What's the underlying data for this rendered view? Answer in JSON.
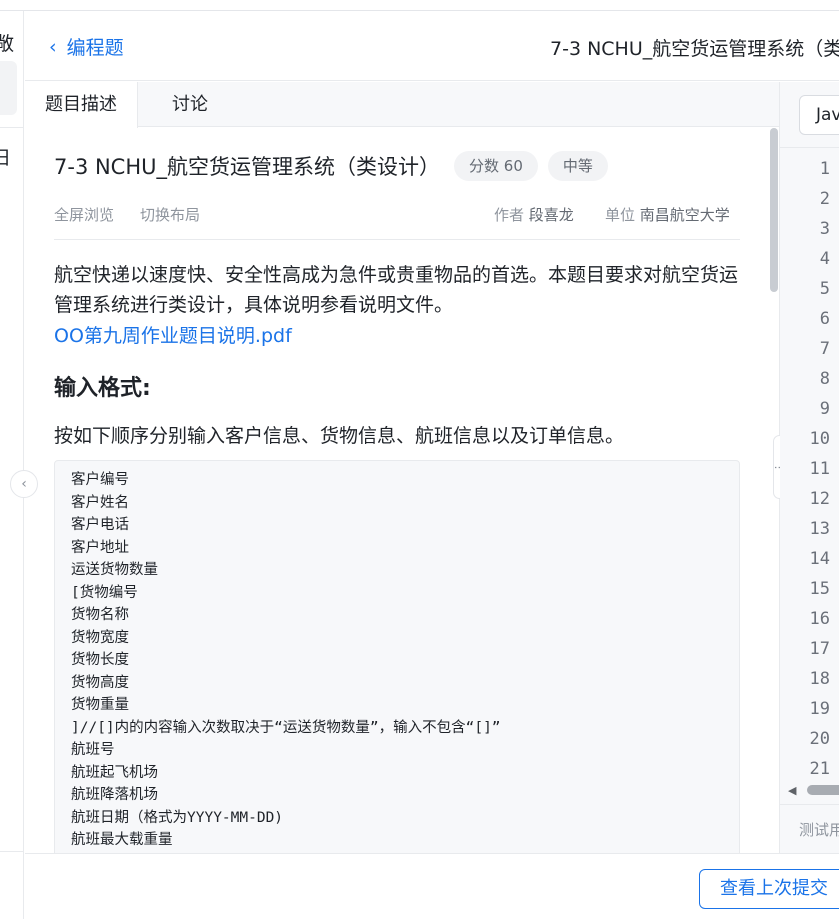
{
  "nav": {
    "fragment_top": "敞",
    "fragment_mid": "日"
  },
  "header": {
    "back_label": "编程题",
    "title": "7-3 NCHU_航空货运管理系统（类"
  },
  "tabs": [
    {
      "label": "题目描述",
      "active": true
    },
    {
      "label": "讨论",
      "active": false
    }
  ],
  "problem": {
    "title": "7-3 NCHU_航空货运管理系统（类设计）",
    "score_chip": "分数 60",
    "difficulty_chip": "中等",
    "actions": [
      "全屏浏览",
      "切换布局"
    ],
    "author_label": "作者",
    "author": "段喜龙",
    "unit_label": "单位",
    "unit": "南昌航空大学",
    "description": "航空快递以速度快、安全性高成为急件或贵重物品的首选。本题目要求对航空货运管理系统进行类设计，具体说明参看说明文件。",
    "attachment": "OO第九周作业题目说明.pdf",
    "input_heading": "输入格式:",
    "input_intro": "按如下顺序分别输入客户信息、货物信息、航班信息以及订单信息。",
    "input_lines": [
      "客户编号",
      "客户姓名",
      "客户电话",
      "客户地址",
      "运送货物数量",
      "[货物编号",
      "货物名称",
      "货物宽度",
      "货物长度",
      "货物高度",
      "货物重量",
      "]//[]内的内容输入次数取决于“运送货物数量”，输入不包含“[]”",
      "航班号",
      "航班起飞机场",
      "航班降落机场",
      "航班日期（格式为YYYY-MM-DD)",
      "航班最大载重量"
    ]
  },
  "editor": {
    "language": "Jav",
    "line_numbers": [
      "1",
      "2",
      "3",
      "4",
      "5",
      "6",
      "7",
      "8",
      "9",
      "10",
      "11",
      "12",
      "13",
      "14",
      "15",
      "16",
      "17",
      "18",
      "19",
      "20",
      "21"
    ],
    "bottom_label": "测试用"
  },
  "footer": {
    "view_last_submit": "查看上次提交"
  }
}
